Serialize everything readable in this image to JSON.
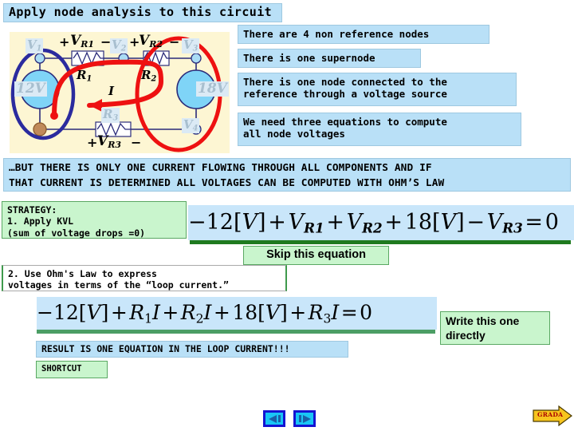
{
  "title": "Apply node analysis to this circuit",
  "bullets": [
    "There are 4 non reference nodes",
    "There is one supernode",
    "There is one node connected to the\nreference through a voltage source",
    "We need three equations to compute\nall node voltages"
  ],
  "banner": "…BUT THERE IS ONLY ONE CURRENT FLOWING THROUGH ALL COMPONENTS AND IF\nTHAT CURRENT IS DETERMINED ALL VOLTAGES CAN BE COMPUTED WITH OHM’S LAW",
  "strategy": {
    "step1": "STRATEGY:\n1. Apply KVL\n(sum of voltage drops =0)",
    "step2": "2. Use Ohm's Law to express\nvoltages in terms of the “loop current.”"
  },
  "annotations": {
    "skip_equation": "Skip this equation",
    "write_directly": "Write this one\ndirectly",
    "result": "RESULT IS ONE EQUATION IN THE LOOP CURRENT!!!",
    "shortcut": "SHORTCUT"
  },
  "equations": {
    "kvl": {
      "tokens": [
        "−",
        "12",
        "[",
        "V",
        "]",
        "+",
        "V",
        "R1",
        "+",
        "V",
        "R2",
        "+",
        "18",
        "[",
        "V",
        "]",
        "−",
        "V",
        "R3",
        "=",
        "0"
      ],
      "plain": "−12[V] + V_R1 + V_R2 + 18[V] − V_R3 = 0"
    },
    "ohm": {
      "plain": "−12[V] + R₁I + R₂I + 18[V] + R₃I = 0"
    }
  },
  "circuit": {
    "labels": {
      "v1": "V",
      "v1s": "1",
      "v2": "V",
      "v2s": "2",
      "v3": "V",
      "v3s": "3",
      "v4": "V",
      "v4s": "4",
      "src_left": "12V",
      "src_right": "18V",
      "r1": "R",
      "r1s": "1",
      "r2": "R",
      "r2s": "2",
      "r3": "R",
      "r3s": "3",
      "vr1_plus": "+",
      "vr1": "V",
      "vr1s": "R1",
      "vr1_minus": "−",
      "vr2_plus": "+",
      "vr2": "V",
      "vr2s": "R2",
      "vr2_minus": "−",
      "vr3_plus": "+",
      "vr3": "V",
      "vr3s": "R3",
      "vr3_minus": "−",
      "current": "I"
    },
    "colors": {
      "supernode_ellipse": "#2b2b9e",
      "node_ellipse": "#ee1111",
      "loop_arrow": "#ee1111",
      "wire": "#2b2b7a",
      "panel_bg": "#fdf6d3",
      "component_fill": "#7fd4f7"
    }
  },
  "nav": {
    "back": "previous-slide",
    "forward": "next-slide",
    "grad": "GRADA"
  }
}
